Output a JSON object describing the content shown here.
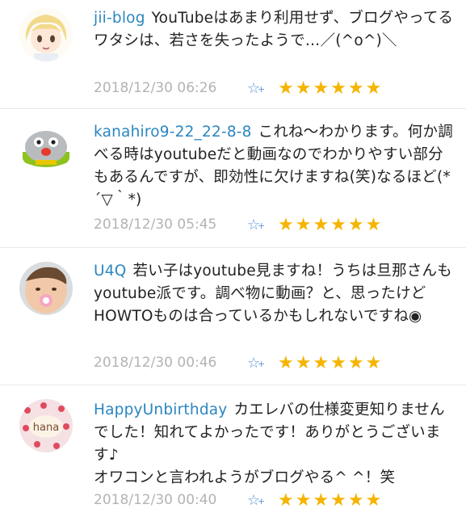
{
  "comments": [
    {
      "user": "jii-blog",
      "text": "YouTubeはあまり利用せず、ブログやってるワタシは、若さを失ったようで…／(^o^)＼",
      "time": "2018/12/30 06:26",
      "stars": "★★★★★★",
      "add_star": "☆+"
    },
    {
      "user": "kanahiro9-22_22-8-8",
      "text": "これね〜わかります。何か調べる時はyoutubeだと動画なのでわかりやすい部分もあるんですが、即効性に欠けますね(笑)なるほど(*´▽｀*)",
      "time": "2018/12/30 05:45",
      "stars": "★★★★★★",
      "add_star": "☆+"
    },
    {
      "user": "U4Q",
      "text": "若い子はyoutube見ますね！うちは旦那さんもyoutube派です。調べ物に動画？と、思ったけどHOWTOものは合っているかもしれないですね◉",
      "time": "2018/12/30 00:46",
      "stars": "★★★★★★",
      "add_star": "☆+"
    },
    {
      "user": "HappyUnbirthday",
      "text": "カエレバの仕様変更知りませんでした！知れてよかったです！ありがとうございます♪\nオワコンと言われようがブログやる^ ^！笑",
      "time": "2018/12/30 00:40",
      "stars": "★★★★★★",
      "add_star": "☆+",
      "avatar_text": "hana"
    }
  ],
  "colors": {
    "username": "#2a86c0",
    "timestamp": "#b3b3b3",
    "star": "#f5b400",
    "add_star": "#5d95d8"
  },
  "icons": {
    "add_star": "add-star-icon",
    "star": "star-icon"
  }
}
